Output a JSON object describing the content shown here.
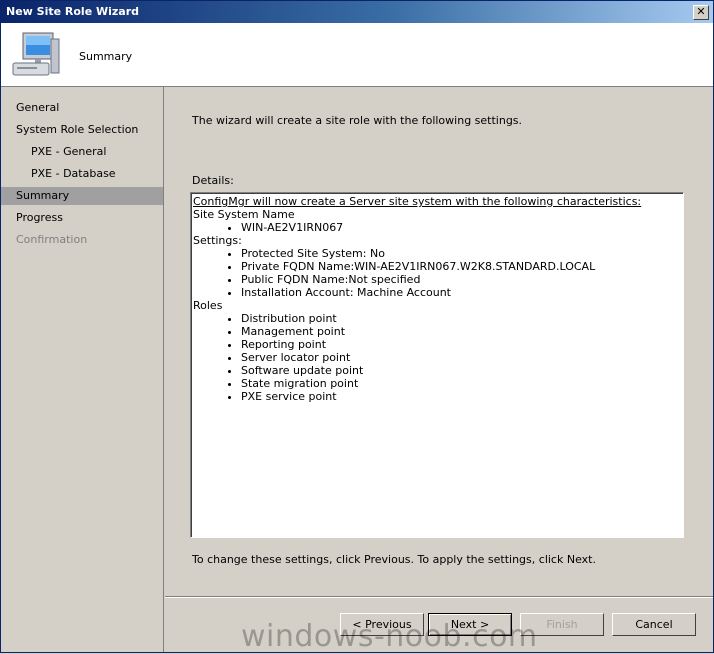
{
  "window": {
    "title": "New Site Role Wizard",
    "close_glyph": "✕"
  },
  "header": {
    "title": "Summary",
    "icon": "computer-monitor-icon"
  },
  "nav": [
    {
      "label": "General",
      "state": "normal"
    },
    {
      "label": "System Role Selection",
      "state": "normal"
    },
    {
      "label": "PXE - General",
      "state": "normal",
      "sub": true
    },
    {
      "label": "PXE - Database",
      "state": "normal",
      "sub": true
    },
    {
      "label": "Summary",
      "state": "selected"
    },
    {
      "label": "Progress",
      "state": "normal"
    },
    {
      "label": "Confirmation",
      "state": "disabled"
    }
  ],
  "main": {
    "intro": "The wizard will create a site role with the following settings.",
    "details_label": "Details:",
    "details": {
      "heading": "ConfigMgr will now create a Server site system with the following characteristics:",
      "site_system_label": "Site System Name",
      "site_system_items": [
        "WIN-AE2V1IRN067"
      ],
      "settings_label": "Settings:",
      "settings_items": [
        "Protected Site System: No",
        "Private FQDN Name:WIN-AE2V1IRN067.W2K8.STANDARD.LOCAL",
        "Public FQDN Name:Not specified",
        "Installation Account: Machine Account"
      ],
      "roles_label": "Roles",
      "roles_items": [
        "Distribution point",
        "Management point",
        "Reporting point",
        "Server locator point",
        "Software update point",
        "State migration point",
        "PXE service point"
      ]
    },
    "footer_text": "To change these settings, click Previous. To apply the settings, click Next."
  },
  "buttons": {
    "previous": "< Previous",
    "next": "Next >",
    "finish": "Finish",
    "cancel": "Cancel"
  },
  "watermark": "windows-noob.com"
}
